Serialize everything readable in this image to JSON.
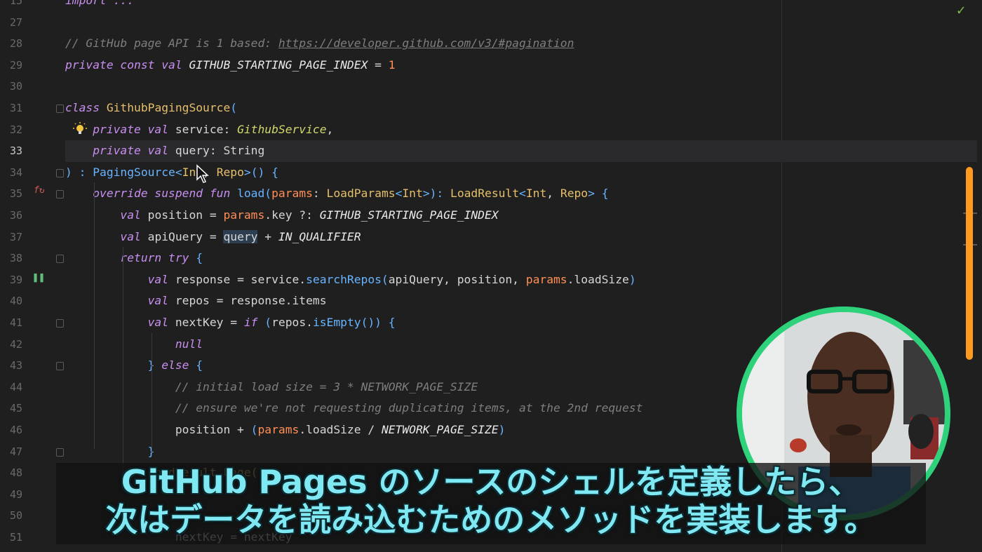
{
  "editor": {
    "lines": [
      {
        "n": "15",
        "tokens": [
          {
            "t": "import ...",
            "c": "kw"
          }
        ]
      },
      {
        "n": "27",
        "tokens": []
      },
      {
        "n": "28",
        "tokens": [
          {
            "t": "// GitHub page API is 1 based: ",
            "c": "cm"
          },
          {
            "t": "https://developer.github.com/v3/#pagination",
            "c": "cmlink"
          }
        ]
      },
      {
        "n": "29",
        "tokens": [
          {
            "t": "private const val ",
            "c": "kw"
          },
          {
            "t": "GITHUB_STARTING_PAGE_INDEX",
            "c": "const"
          },
          {
            "t": " = ",
            "c": ""
          },
          {
            "t": "1",
            "c": "num"
          }
        ]
      },
      {
        "n": "30",
        "tokens": []
      },
      {
        "n": "31",
        "tokens": [
          {
            "t": "class ",
            "c": "kw"
          },
          {
            "t": "GithubPagingSource",
            "c": "cls"
          },
          {
            "t": "(",
            "c": "pn"
          }
        ]
      },
      {
        "n": "32",
        "tokens": [
          {
            "t": "    private val ",
            "c": "kw"
          },
          {
            "t": "service: ",
            "c": ""
          },
          {
            "t": "GithubService",
            "c": "typ"
          },
          {
            "t": ",",
            "c": ""
          }
        ]
      },
      {
        "n": "33",
        "tokens": [
          {
            "t": "    private val ",
            "c": "kw"
          },
          {
            "t": "query: String",
            "c": ""
          }
        ]
      },
      {
        "n": "34",
        "tokens": [
          {
            "t": ") : ",
            "c": "pn"
          },
          {
            "t": "PagingSource",
            "c": "fn"
          },
          {
            "t": "<",
            "c": "pn"
          },
          {
            "t": "Int",
            "c": "cls"
          },
          {
            "t": ", ",
            "c": ""
          },
          {
            "t": "Repo",
            "c": "cls"
          },
          {
            "t": ">() {",
            "c": "pn"
          }
        ]
      },
      {
        "n": "35",
        "tokens": [
          {
            "t": "    override suspend fun ",
            "c": "kw"
          },
          {
            "t": "load",
            "c": "fn"
          },
          {
            "t": "(",
            "c": "pn"
          },
          {
            "t": "params",
            "c": "prm"
          },
          {
            "t": ": ",
            "c": ""
          },
          {
            "t": "LoadParams",
            "c": "cls"
          },
          {
            "t": "<",
            "c": "pn"
          },
          {
            "t": "Int",
            "c": "cls"
          },
          {
            "t": ">): ",
            "c": "pn"
          },
          {
            "t": "LoadResult",
            "c": "cls"
          },
          {
            "t": "<",
            "c": "pn"
          },
          {
            "t": "Int",
            "c": "cls"
          },
          {
            "t": ", ",
            "c": ""
          },
          {
            "t": "Repo",
            "c": "cls"
          },
          {
            "t": "> {",
            "c": "pn"
          }
        ]
      },
      {
        "n": "36",
        "tokens": [
          {
            "t": "        val ",
            "c": "kw"
          },
          {
            "t": "position = ",
            "c": ""
          },
          {
            "t": "params",
            "c": "prm"
          },
          {
            "t": ".key ?: ",
            "c": ""
          },
          {
            "t": "GITHUB_STARTING_PAGE_INDEX",
            "c": "const"
          }
        ]
      },
      {
        "n": "37",
        "tokens": [
          {
            "t": "        val ",
            "c": "kw"
          },
          {
            "t": "apiQuery = ",
            "c": ""
          },
          {
            "t": "query",
            "c": "hl"
          },
          {
            "t": " + ",
            "c": ""
          },
          {
            "t": "IN_QUALIFIER",
            "c": "const"
          }
        ]
      },
      {
        "n": "38",
        "tokens": [
          {
            "t": "        return try ",
            "c": "kw"
          },
          {
            "t": "{",
            "c": "pn"
          }
        ]
      },
      {
        "n": "39",
        "tokens": [
          {
            "t": "            val ",
            "c": "kw"
          },
          {
            "t": "response = service.",
            "c": ""
          },
          {
            "t": "searchRepos",
            "c": "fn"
          },
          {
            "t": "(",
            "c": "pn"
          },
          {
            "t": "apiQuery, position, ",
            "c": ""
          },
          {
            "t": "params",
            "c": "prm"
          },
          {
            "t": ".loadSize",
            "c": ""
          },
          {
            "t": ")",
            "c": "pn"
          }
        ]
      },
      {
        "n": "40",
        "tokens": [
          {
            "t": "            val ",
            "c": "kw"
          },
          {
            "t": "repos = response.items",
            "c": ""
          }
        ]
      },
      {
        "n": "41",
        "tokens": [
          {
            "t": "            val ",
            "c": "kw"
          },
          {
            "t": "nextKey = ",
            "c": ""
          },
          {
            "t": "if ",
            "c": "kw"
          },
          {
            "t": "(",
            "c": "pn"
          },
          {
            "t": "repos.",
            "c": ""
          },
          {
            "t": "isEmpty",
            "c": "fn"
          },
          {
            "t": "()) {",
            "c": "pn"
          }
        ]
      },
      {
        "n": "42",
        "tokens": [
          {
            "t": "                null",
            "c": "kw"
          }
        ]
      },
      {
        "n": "43",
        "tokens": [
          {
            "t": "            } ",
            "c": "pn"
          },
          {
            "t": "else ",
            "c": "kw"
          },
          {
            "t": "{",
            "c": "pn"
          }
        ]
      },
      {
        "n": "44",
        "tokens": [
          {
            "t": "                // initial load size = 3 * NETWORK_PAGE_SIZE",
            "c": "cm"
          }
        ]
      },
      {
        "n": "45",
        "tokens": [
          {
            "t": "                // ensure we're not requesting duplicating items, at the 2nd request",
            "c": "cm"
          }
        ]
      },
      {
        "n": "46",
        "tokens": [
          {
            "t": "                position + ",
            "c": ""
          },
          {
            "t": "(",
            "c": "pn"
          },
          {
            "t": "params",
            "c": "prm"
          },
          {
            "t": ".loadSize / ",
            "c": ""
          },
          {
            "t": "NETWORK_PAGE_SIZE",
            "c": "const"
          },
          {
            "t": ")",
            "c": "pn"
          }
        ]
      },
      {
        "n": "47",
        "tokens": [
          {
            "t": "            }",
            "c": "pn"
          }
        ]
      },
      {
        "n": "48",
        "tokens": [
          {
            "t": "            LoadResult.Page(",
            "c": "cls"
          }
        ]
      },
      {
        "n": "49",
        "tokens": []
      },
      {
        "n": "50",
        "tokens": []
      },
      {
        "n": "51",
        "tokens": [
          {
            "t": "                nextKey = nextKey",
            "c": ""
          }
        ]
      }
    ]
  },
  "subtitle": {
    "line1": "GitHub Pages のソースのシェルを定義したら、",
    "line2": "次はデータを読み込むためのメソッドを実装します。"
  },
  "icons": {
    "check": "checkmark-icon",
    "bulb": "lightbulb-icon",
    "fx": "function-recursion-icon",
    "pause": "pause-icon"
  },
  "colors": {
    "accent_ring": "#2dd27b",
    "scroll_thumb": "#ff9a1f",
    "subtitle_text": "#7fe8f3"
  }
}
